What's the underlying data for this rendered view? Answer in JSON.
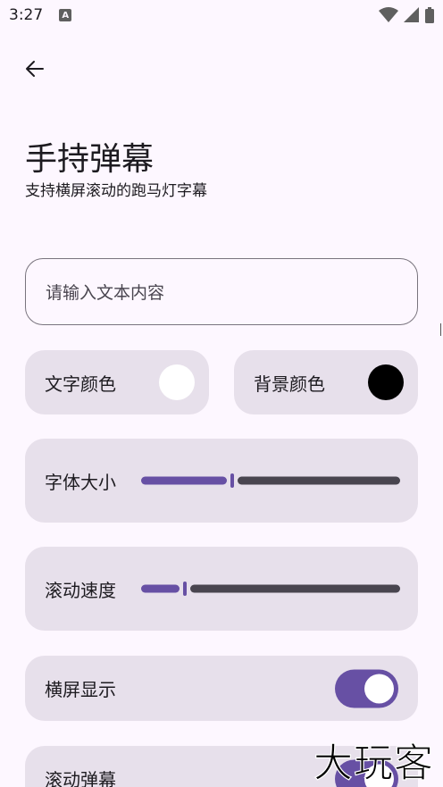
{
  "status_bar": {
    "time": "3:27",
    "notification_icon": "a-letter-icon",
    "icons": [
      "wifi-icon",
      "signal-icon",
      "battery-icon"
    ]
  },
  "header": {
    "back_icon": "arrow-left-icon",
    "title": "手持弹幕",
    "subtitle": "支持横屏滚动的跑马灯字幕"
  },
  "input": {
    "placeholder": "请输入文本内容",
    "value": ""
  },
  "colors": {
    "text_color_label": "文字颜色",
    "text_color_value": "#ffffff",
    "background_color_label": "背景颜色",
    "background_color_value": "#000000",
    "accent": "#6750a4"
  },
  "font_size": {
    "label": "字体大小",
    "fraction": 0.35
  },
  "scroll_speed": {
    "label": "滚动速度",
    "fraction": 0.17
  },
  "landscape": {
    "label": "横屏显示",
    "enabled": true
  },
  "scroll_danmaku": {
    "label": "滚动弹幕",
    "enabled": true
  },
  "watermark": "大玩客"
}
